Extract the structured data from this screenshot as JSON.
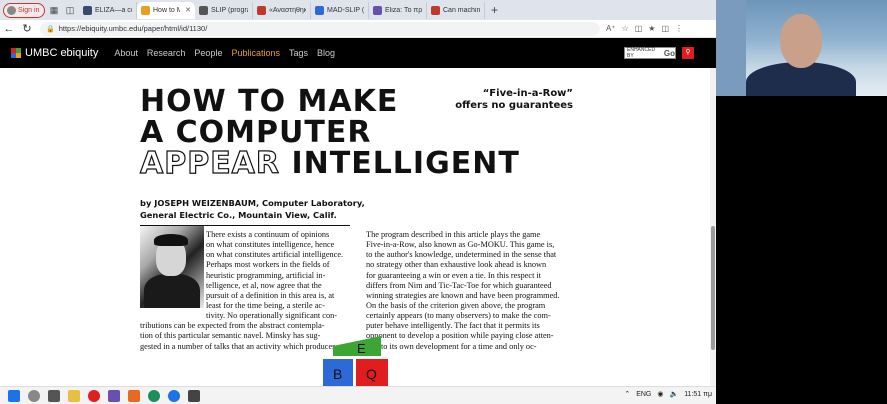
{
  "browser": {
    "profile_label": "Sign in",
    "tabs": [
      {
        "title": "ELIZA—a com",
        "color": "#3a4a6b"
      },
      {
        "title": "How to Make",
        "color": "#e8a020",
        "active": true
      },
      {
        "title": "SLIP (program",
        "color": "#555555"
      },
      {
        "title": "«Αναστήθηκε",
        "color": "#c0392b"
      },
      {
        "title": "MAD-SLIP (Mi",
        "color": "#2d6ad8"
      },
      {
        "title": "Eliza: Το πρώτ",
        "color": "#6a4fb3"
      },
      {
        "title": "Can machines",
        "color": "#c0392b"
      }
    ],
    "url": "https://ebiquity.umbc.edu/paper/html/id/1130/"
  },
  "site": {
    "logo_text": "UMBC ebiquity",
    "menu": [
      "About",
      "Research",
      "People",
      "Publications",
      "Tags",
      "Blog"
    ],
    "active_menu": "Publications",
    "search_placeholder": "ENHANCED BY",
    "search_brand": "Go"
  },
  "article": {
    "title_lines": [
      "HOW TO MAKE",
      "A COMPUTER"
    ],
    "title_line3_outline": "APPEAR",
    "title_line3_solid": "INTELLIGENT",
    "tagline_1": "“Five-in-a-Row”",
    "tagline_2": "offers no guarantees",
    "byline_1": "by JOSEPH WEIZENBAUM, Computer Laboratory,",
    "byline_2": "General Electric Co., Mountain View, Calif.",
    "col1": [
      "There exists a continuum of opinions",
      "on what constitutes intelligence, hence",
      "on what constitutes artificial intelligence.",
      "Perhaps most workers in the fields of",
      "heuristic programming, artificial in-",
      "telligence, et al, now agree that the",
      "pursuit of a definition in this area is, at",
      "least for the time being, a sterile ac-",
      "tivity. No operationally significant con-",
      "tributions can be expected from the abstract contempla-",
      "tion of this particular semantic navel. Minsky has sug-",
      "gested in a number of talks that an activity which produces"
    ],
    "col2": [
      "The program described in this article plays the game",
      "Five-in-a-Row, also known as Go-MOKU. This game is,",
      "to the author's knowledge, undetermined in the sense that",
      "no strategy other than exhaustive look ahead is known",
      "for guaranteeing a win or even a tie. In this respect it",
      "differs from Nim and Tic-Tac-Toe for which guaranteed",
      "winning strategies are known and have been programmed.",
      "On the basis of the criterion given above, the program",
      "certainly appears (to many observers) to make the com-",
      "puter behave intelligently. The fact that it permits its",
      "opponent to develop a position while paying close atten-",
      "tion to its own development for a time and only oc-"
    ],
    "logo_letters": [
      "E",
      "B",
      "Q"
    ]
  },
  "taskbar": {
    "language": "ENG",
    "time": "11:51 πμ"
  },
  "colors": {
    "nav_bg": "#000000",
    "active_link": "#e8a020",
    "search_button": "#e21d1d"
  }
}
